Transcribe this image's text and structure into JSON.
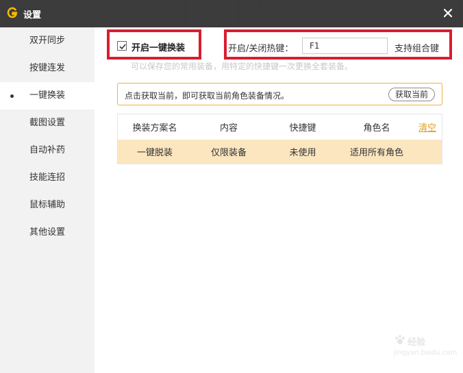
{
  "window": {
    "title": "设置",
    "logo_icon": "g-logo-icon",
    "close_icon": "close-icon"
  },
  "sidebar": {
    "items": [
      {
        "label": "双开同步",
        "active": false
      },
      {
        "label": "按键连发",
        "active": false
      },
      {
        "label": "一键换装",
        "active": true
      },
      {
        "label": "截图设置",
        "active": false
      },
      {
        "label": "自动补药",
        "active": false
      },
      {
        "label": "技能连招",
        "active": false
      },
      {
        "label": "鼠标辅助",
        "active": false
      },
      {
        "label": "其他设置",
        "active": false
      }
    ]
  },
  "main": {
    "enable_checkbox": {
      "label": "开启一键换装",
      "checked": true
    },
    "hotkey": {
      "label": "开启/关闭热键：",
      "value": "F1",
      "combo_label": "支持组合键"
    },
    "hint": "可以保存您的常用装备，用特定的快捷键一次更换全套装备。",
    "notice": {
      "text": "点击获取当前，即可获取当前角色装备情况。",
      "button_label": "获取当前"
    },
    "table": {
      "headers": [
        "换装方案名",
        "内容",
        "快捷键",
        "角色名"
      ],
      "clear_label": "清空",
      "rows": [
        [
          "一键脱装",
          "仅限装备",
          "未使用",
          "适用所有角色"
        ]
      ]
    }
  },
  "watermark": {
    "line1": "经验",
    "line2": "jingyan.baidu.com"
  },
  "colors": {
    "titlebar": "#3a3a3a",
    "accent": "#f0b040",
    "highlight_border": "#d81e2e",
    "selected_row": "#fbe6c0",
    "clear_link": "#e0a020"
  }
}
